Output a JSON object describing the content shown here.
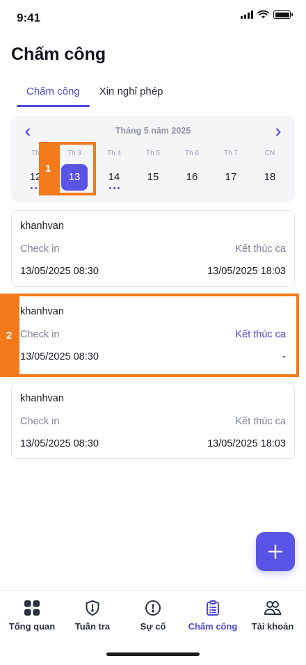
{
  "status_bar": {
    "time": "9:41"
  },
  "page_title": "Chấm công",
  "tabs": [
    {
      "label": "Chấm công",
      "active": true
    },
    {
      "label": "Xin nghỉ phép",
      "active": false
    }
  ],
  "calendar": {
    "month_label": "Tháng 5 năm 2025",
    "days": [
      {
        "weekday": "Th",
        "date": "12",
        "has_dots": true
      },
      {
        "weekday": "Th 3",
        "date": "13",
        "selected": true,
        "has_dots": false
      },
      {
        "weekday": "Th 4",
        "date": "14",
        "has_dots": true
      },
      {
        "weekday": "Th 5",
        "date": "15",
        "has_dots": false
      },
      {
        "weekday": "Th 6",
        "date": "16",
        "has_dots": false
      },
      {
        "weekday": "Th 7",
        "date": "17",
        "has_dots": false
      },
      {
        "weekday": "CN",
        "date": "18",
        "has_dots": false
      }
    ]
  },
  "records": [
    {
      "user": "khanhvan",
      "check_in_label": "Check in",
      "end_label": "Kết thúc ca",
      "check_in": "13/05/2025 08:30",
      "end": "13/05/2025 18:03"
    },
    {
      "user": "khanhvan",
      "check_in_label": "Check in",
      "end_label": "Kết thúc ca",
      "check_in": "13/05/2025 08:30",
      "end": "-"
    },
    {
      "user": "khanhvan",
      "check_in_label": "Check in",
      "end_label": "Kết thúc ca",
      "check_in": "13/05/2025 08:30",
      "end": "13/05/2025 18:03"
    }
  ],
  "annotations": {
    "first": "1",
    "second": "2"
  },
  "fab": {
    "icon": "plus-icon"
  },
  "bottom_nav": [
    {
      "label": "Tổng quan",
      "icon": "grid-icon"
    },
    {
      "label": "Tuần tra",
      "icon": "shield-icon"
    },
    {
      "label": "Sự cố",
      "icon": "alert-icon"
    },
    {
      "label": "Chấm công",
      "icon": "clipboard-icon",
      "active": true
    },
    {
      "label": "Tài khoản",
      "icon": "users-icon"
    }
  ],
  "colors": {
    "accent": "#4e47e0",
    "selected_day": "#5a54e6",
    "annotation": "#f27a1a"
  }
}
